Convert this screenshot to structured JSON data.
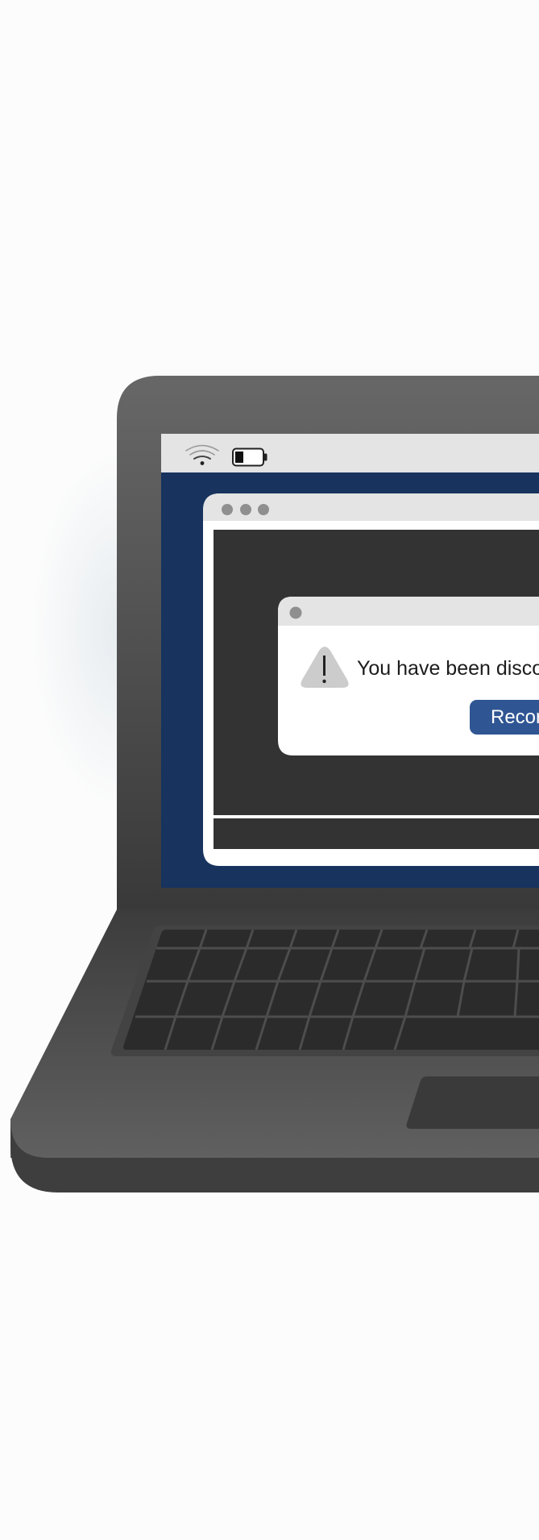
{
  "dialog": {
    "message": "You have been disco",
    "reconnect_label": "Recor"
  },
  "status_bar": {
    "wifi_icon": "wifi-icon",
    "battery_icon": "battery-low-icon"
  },
  "colors": {
    "desktop_background": "#17335e",
    "window_background": "#333333",
    "titlebar": "#e5e5e5",
    "primary_button": "#2f5593",
    "laptop_body": "#5f5f5f"
  }
}
